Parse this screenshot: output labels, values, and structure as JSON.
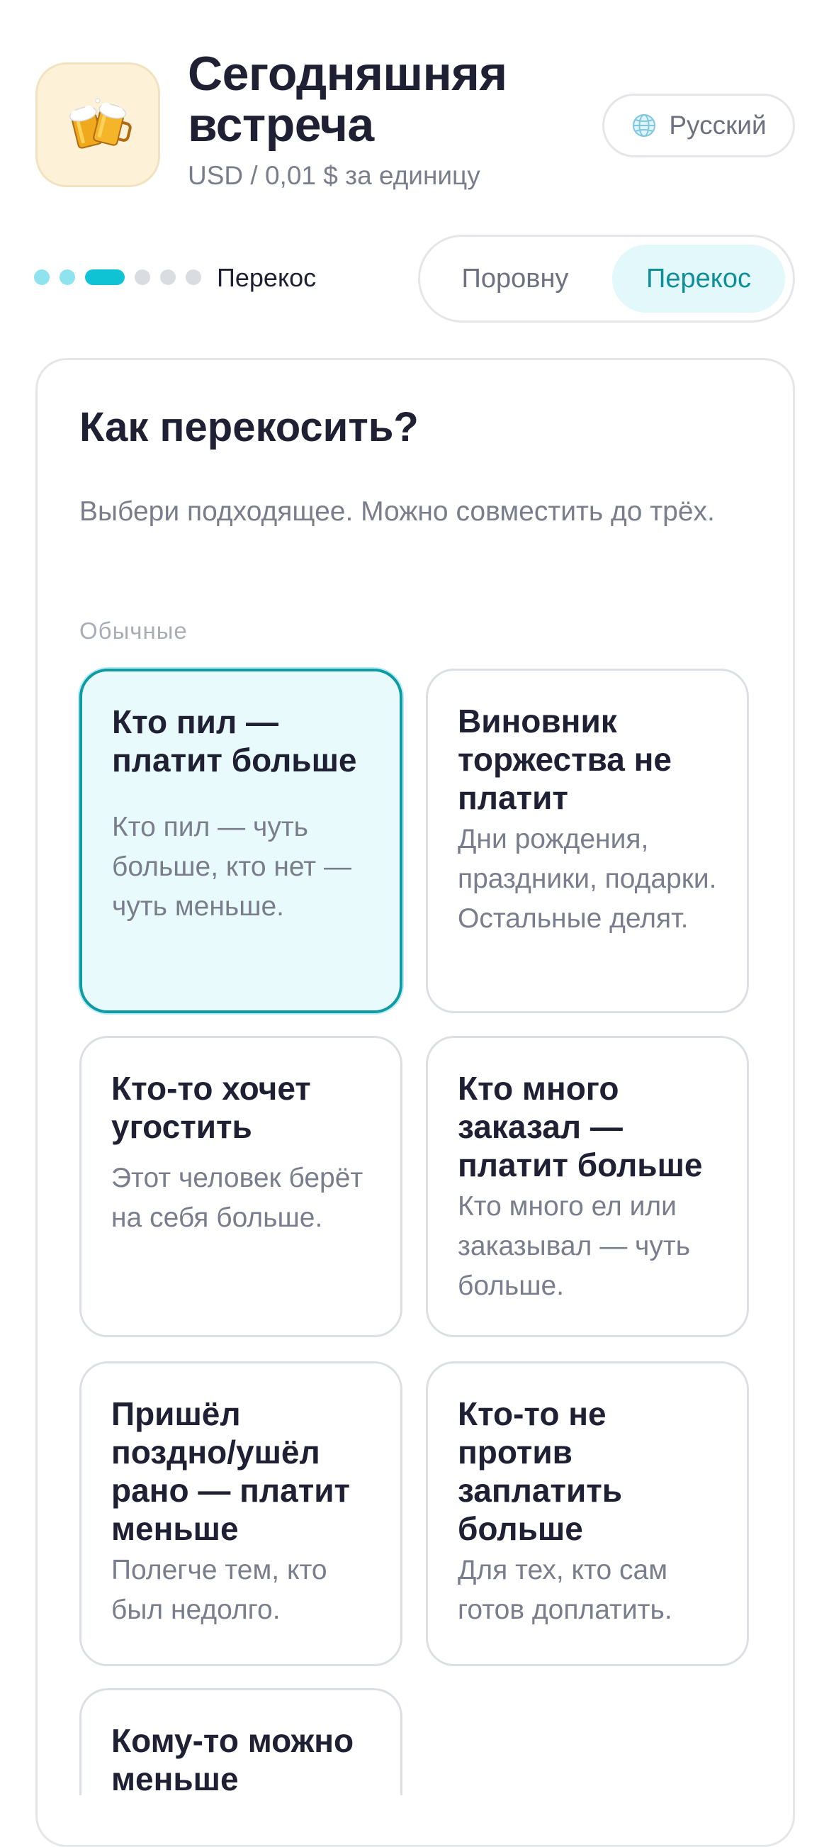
{
  "header": {
    "title": "Сегодняшняя встреча",
    "subtitle": "USD / 0,01 $ за единицу",
    "app_icon": "beer-mugs-icon",
    "language": {
      "icon": "globe-icon",
      "label": "Русский"
    }
  },
  "stepper": {
    "total_steps": 6,
    "current_step": 3,
    "current_label": "Перекос"
  },
  "mode_switch": {
    "options": [
      "Поровну",
      "Перекос"
    ],
    "selected": "Перекос"
  },
  "panel": {
    "title": "Как перекосить?",
    "description": "Выбери подходящее. Можно совместить до трёх.",
    "group_label": "Обычные",
    "options": [
      {
        "title": "Кто пил — платит больше",
        "desc": "Кто пил — чуть больше, кто нет — чуть меньше.",
        "selected": true
      },
      {
        "title": "Виновник торжества не платит",
        "desc": "Дни рождения, праздники, подарки. Остальные делят.",
        "selected": false
      },
      {
        "title": "Кто-то хочет угостить",
        "desc": "Этот человек берёт на себя больше.",
        "selected": false
      },
      {
        "title": "Кто много заказал — платит больше",
        "desc": "Кто много ел или заказывал — чуть больше.",
        "selected": false
      },
      {
        "title": "Пришёл поздно/ушёл рано — платит меньше",
        "desc": "Полегче тем, кто был недолго.",
        "selected": false
      },
      {
        "title": "Кто-то не против заплатить больше",
        "desc": "Для тех, кто сам готов доплатить.",
        "selected": false
      },
      {
        "title": "Кому-то можно меньше",
        "desc": "",
        "selected": false
      }
    ]
  },
  "colors": {
    "accent": "#10c3d4",
    "accent_dark": "#0f9ba4",
    "selected_bg": "#e9fafd",
    "text_primary": "#1f2033",
    "text_secondary": "#7a7e8c"
  }
}
